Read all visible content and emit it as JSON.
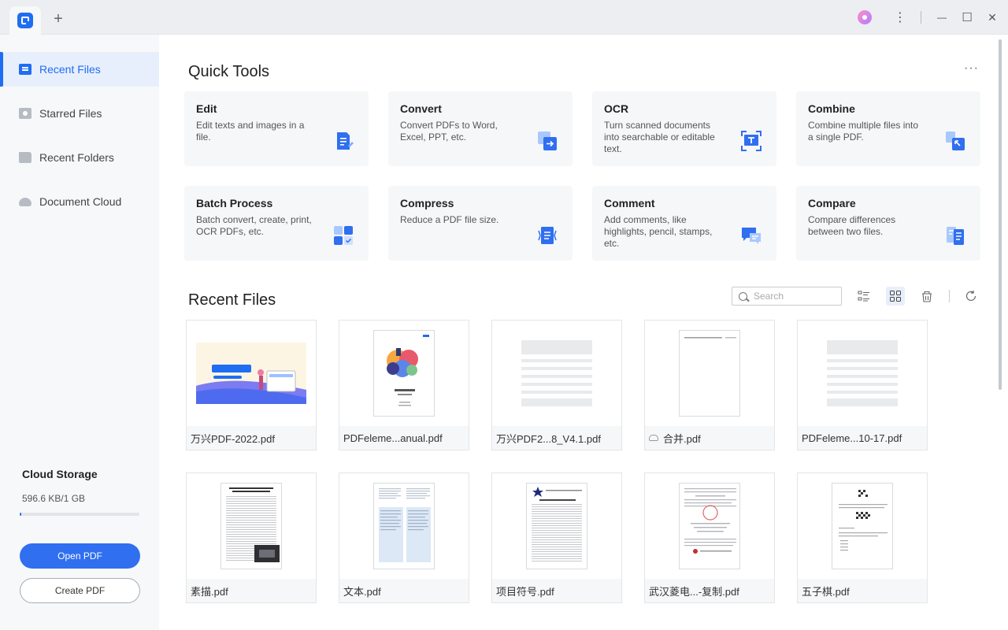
{
  "titlebar": {
    "new_tab": "+",
    "more": "⋮",
    "minimize": "—",
    "maximize": "☐",
    "close": "✕"
  },
  "sidebar": {
    "items": [
      {
        "label": "Recent Files",
        "icon": "recent-files-icon",
        "active": true
      },
      {
        "label": "Starred Files",
        "icon": "star-icon",
        "active": false
      },
      {
        "label": "Recent Folders",
        "icon": "folder-icon",
        "active": false
      },
      {
        "label": "Document Cloud",
        "icon": "cloud-icon",
        "active": false
      }
    ],
    "cloud": {
      "title": "Cloud Storage",
      "usage": "596.6 KB/1 GB",
      "fill_fraction": 0.0006
    },
    "open_pdf": "Open PDF",
    "create_pdf": "Create PDF"
  },
  "quick_tools": {
    "title": "Quick Tools",
    "more": "···",
    "tools": [
      {
        "title": "Edit",
        "desc": "Edit texts and images in a file.",
        "icon": "edit-icon"
      },
      {
        "title": "Convert",
        "desc": "Convert PDFs to Word, Excel, PPT, etc.",
        "icon": "convert-icon"
      },
      {
        "title": "OCR",
        "desc": "Turn scanned documents into searchable or editable text.",
        "icon": "ocr-icon"
      },
      {
        "title": "Combine",
        "desc": "Combine multiple files into a single PDF.",
        "icon": "combine-icon"
      },
      {
        "title": "Batch Process",
        "desc": "Batch convert, create, print, OCR PDFs, etc.",
        "icon": "batch-icon"
      },
      {
        "title": "Compress",
        "desc": "Reduce a PDF file size.",
        "icon": "compress-icon"
      },
      {
        "title": "Comment",
        "desc": "Add comments, like highlights, pencil, stamps, etc.",
        "icon": "comment-icon"
      },
      {
        "title": "Compare",
        "desc": "Compare differences between two files.",
        "icon": "compare-icon"
      }
    ]
  },
  "recent_files": {
    "title": "Recent Files",
    "search_placeholder": "Search",
    "files": [
      {
        "name": "万兴PDF-2022.pdf",
        "thumb": "banner",
        "cloud": false
      },
      {
        "name": "PDFeleme...anual.pdf",
        "thumb": "cover",
        "cloud": false
      },
      {
        "name": "万兴PDF2...8_V4.1.pdf",
        "thumb": "gray",
        "cloud": false
      },
      {
        "name": "合并.pdf",
        "thumb": "blank",
        "cloud": true
      },
      {
        "name": "PDFeleme...10-17.pdf",
        "thumb": "gray",
        "cloud": false
      },
      {
        "name": "素描.pdf",
        "thumb": "paper",
        "cloud": false
      },
      {
        "name": "文本.pdf",
        "thumb": "blue",
        "cloud": false
      },
      {
        "name": "项目符号.pdf",
        "thumb": "text",
        "cloud": false
      },
      {
        "name": "武汉菱电...-复制.pdf",
        "thumb": "stamp",
        "cloud": false
      },
      {
        "name": "五子棋.pdf",
        "thumb": "chess",
        "cloud": false
      }
    ]
  },
  "colors": {
    "accent": "#1f6df2",
    "sidebar_active_bg": "#e8effc",
    "card_bg": "#f6f7f9"
  }
}
